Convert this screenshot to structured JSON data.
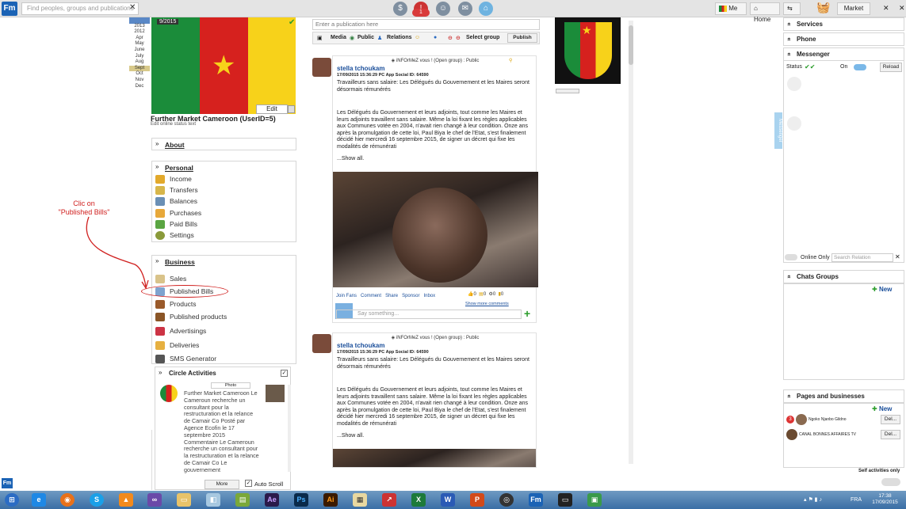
{
  "app": {
    "logo": "Fm"
  },
  "topbar": {
    "search_placeholder": "Find peoples, groups and publications",
    "notif_count": "1",
    "me_label": "Me",
    "home_label": "Home",
    "market_label": "Market"
  },
  "years": [
    "2013",
    "2012",
    "Apr",
    "May",
    "June",
    "July",
    "Aug",
    "Sept",
    "Oct",
    "Nov",
    "Dec"
  ],
  "profile": {
    "photo_count": "9/2015",
    "edit_label": "Edit",
    "name": "Further Market Cameroon (UserID=5)",
    "status_hint": "Edit online status text"
  },
  "about": {
    "title": "About"
  },
  "personal": {
    "title": "Personal",
    "items": [
      "Income",
      "Transfers",
      "Balances",
      "Purchases",
      "Paid Bills",
      "Settings"
    ]
  },
  "business": {
    "title": "Business",
    "items": [
      "Sales",
      "Published Bills",
      "Products",
      "Published products",
      "Advertisings",
      "Deliveries",
      "SMS Generator"
    ]
  },
  "circle": {
    "title": "Circle Activities",
    "photo_label": "Photo",
    "text": "Further Market Cameroon Le Cameroun recherche un consultant pour la restructuration et la relance de Camair Co Posté par Agence Ecofin le 17 septembre 2015 Commentaire Le Cameroun recherche un consultant pour la restructuration et la relance de Camair Co Le gouvernement",
    "more_label": "More",
    "autoscroll_label": "Auto Scroll"
  },
  "annotation": {
    "line1": "Clic on",
    "line2": "\"Published Bills\""
  },
  "publish": {
    "placeholder": "Enter a publication here",
    "media_label": "Media",
    "public_label": "Public",
    "relations_label": "Relations",
    "select_group_label": "Select group",
    "publish_label": "Publish"
  },
  "posts": [
    {
      "header": "iNFOrMeZ vous ! (Open group) : Public",
      "author": "stella tchoukam",
      "meta": "17/09/2015 15:36:29  PC App  Social ID: 64590",
      "title": "Travailleurs sans salaire: Les Délégués du Gouvernement et les Maires seront désormais rémunérés",
      "body": "Les Délégués du Gouvernement et leurs adjoints, tout comme les Maires et leurs adjoints travaillent sans salaire. Même la loi fixant les règles applicables aux Communes votée en 2004, n'avait rien changé à leur condition. Onze ans après la promulgation de cette loi, Paul Biya le chef de l'Etat, s'est finalement décidé hier mercredi 16 septembre 2015, de signer un décret qui fixe les modalités de rémunérati",
      "show_all": "...Show all.",
      "actions": [
        "Join Fans",
        "Comment",
        "Share",
        "Sponsor",
        "Inbox"
      ],
      "counts": [
        "0",
        "0",
        "0",
        "0"
      ],
      "show_more_comments": "Show more comments",
      "comment_placeholder": "Say something..."
    },
    {
      "header": "iNFOrMeZ vous ! (Open group) : Public",
      "author": "stella tchoukam",
      "meta": "17/09/2015 15:36:29  PC App  Social ID: 64590",
      "title": "Travailleurs sans salaire: Les Délégués du Gouvernement et les Maires seront désormais rémunérés",
      "body": "Les Délégués du Gouvernement et leurs adjoints, tout comme les Maires et leurs adjoints travaillent sans salaire. Même la loi fixant les règles applicables aux Communes votée en 2004, n'avait rien changé à leur condition. Onze ans après la promulgation de cette loi, Paul Biya le chef de l'Etat, s'est finalement décidé hier mercredi 16 septembre 2015, de signer un décret qui fixe les modalités de rémunérati",
      "show_all": "...Show all."
    }
  ],
  "right": {
    "services": "Services",
    "phone": "Phone",
    "messenger": "Messenger",
    "status_label": "Status",
    "on_label": "On",
    "reload_label": "Reload",
    "online_only": "Online Only",
    "search_relation": "Search Relation",
    "side_tab": "Messenger",
    "chats_groups": "Chats Groups",
    "new_label": "New",
    "pages_title": "Pages and businesses",
    "pages": [
      {
        "badge": "3",
        "name": "Ngoko Njanbo Gildno",
        "action": "Del..."
      },
      {
        "badge": "",
        "name": "CANAL BONNES AFFAIRES TV",
        "action": "Del..."
      }
    ],
    "self_activities": "Self activities only"
  },
  "taskbar": {
    "lang": "FRA",
    "time": "17:38",
    "date": "17/09/2015"
  }
}
